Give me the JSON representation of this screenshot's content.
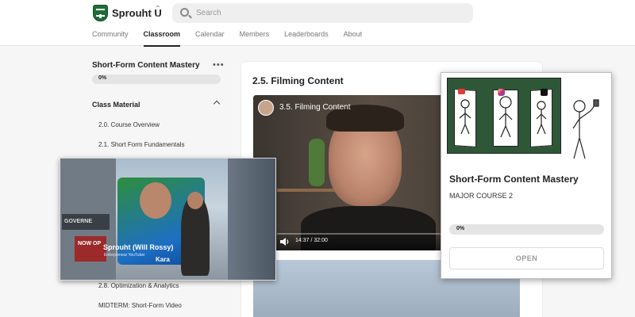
{
  "topbar": {
    "group_name": "Sprouht U",
    "switcher_icon": "chevron-up-down",
    "search_placeholder": "Search"
  },
  "nav": {
    "items": [
      "Community",
      "Classroom",
      "Calendar",
      "Members",
      "Leaderboards",
      "About"
    ],
    "active": "Classroom"
  },
  "sidebar": {
    "course_title": "Short-Form Content Mastery",
    "progress_label": "0%",
    "progress": 0,
    "section_title": "Class Material",
    "lessons": [
      "2.0. Course Overview",
      "2.1. Short Form Fundamentals",
      "2.8. Optimization & Analytics",
      "MIDTERM: Short-Form Video"
    ]
  },
  "main": {
    "lesson_title": "2.5. Filming Content",
    "video": {
      "title": "3.5. Filming Content",
      "time": "14:37 / 32:00"
    }
  },
  "overlay_photo": {
    "billboard_name": "Sprouht (Will Rossy)",
    "billboard_sub": "Entrepreneur YouTuber",
    "billboard_brand": "Kara",
    "left_sign": "GOVERNE",
    "red_sign": "NOW OP"
  },
  "course_card": {
    "title": "Short-Form Content Mastery",
    "subtitle": "MAJOR COURSE 2",
    "progress_label": "0%",
    "progress": 0,
    "button_label": "OPEN"
  },
  "colors": {
    "brand_green": "#1f6b3a",
    "thumb_green": "#2e5738",
    "progress_bg": "#e4e4e4"
  }
}
